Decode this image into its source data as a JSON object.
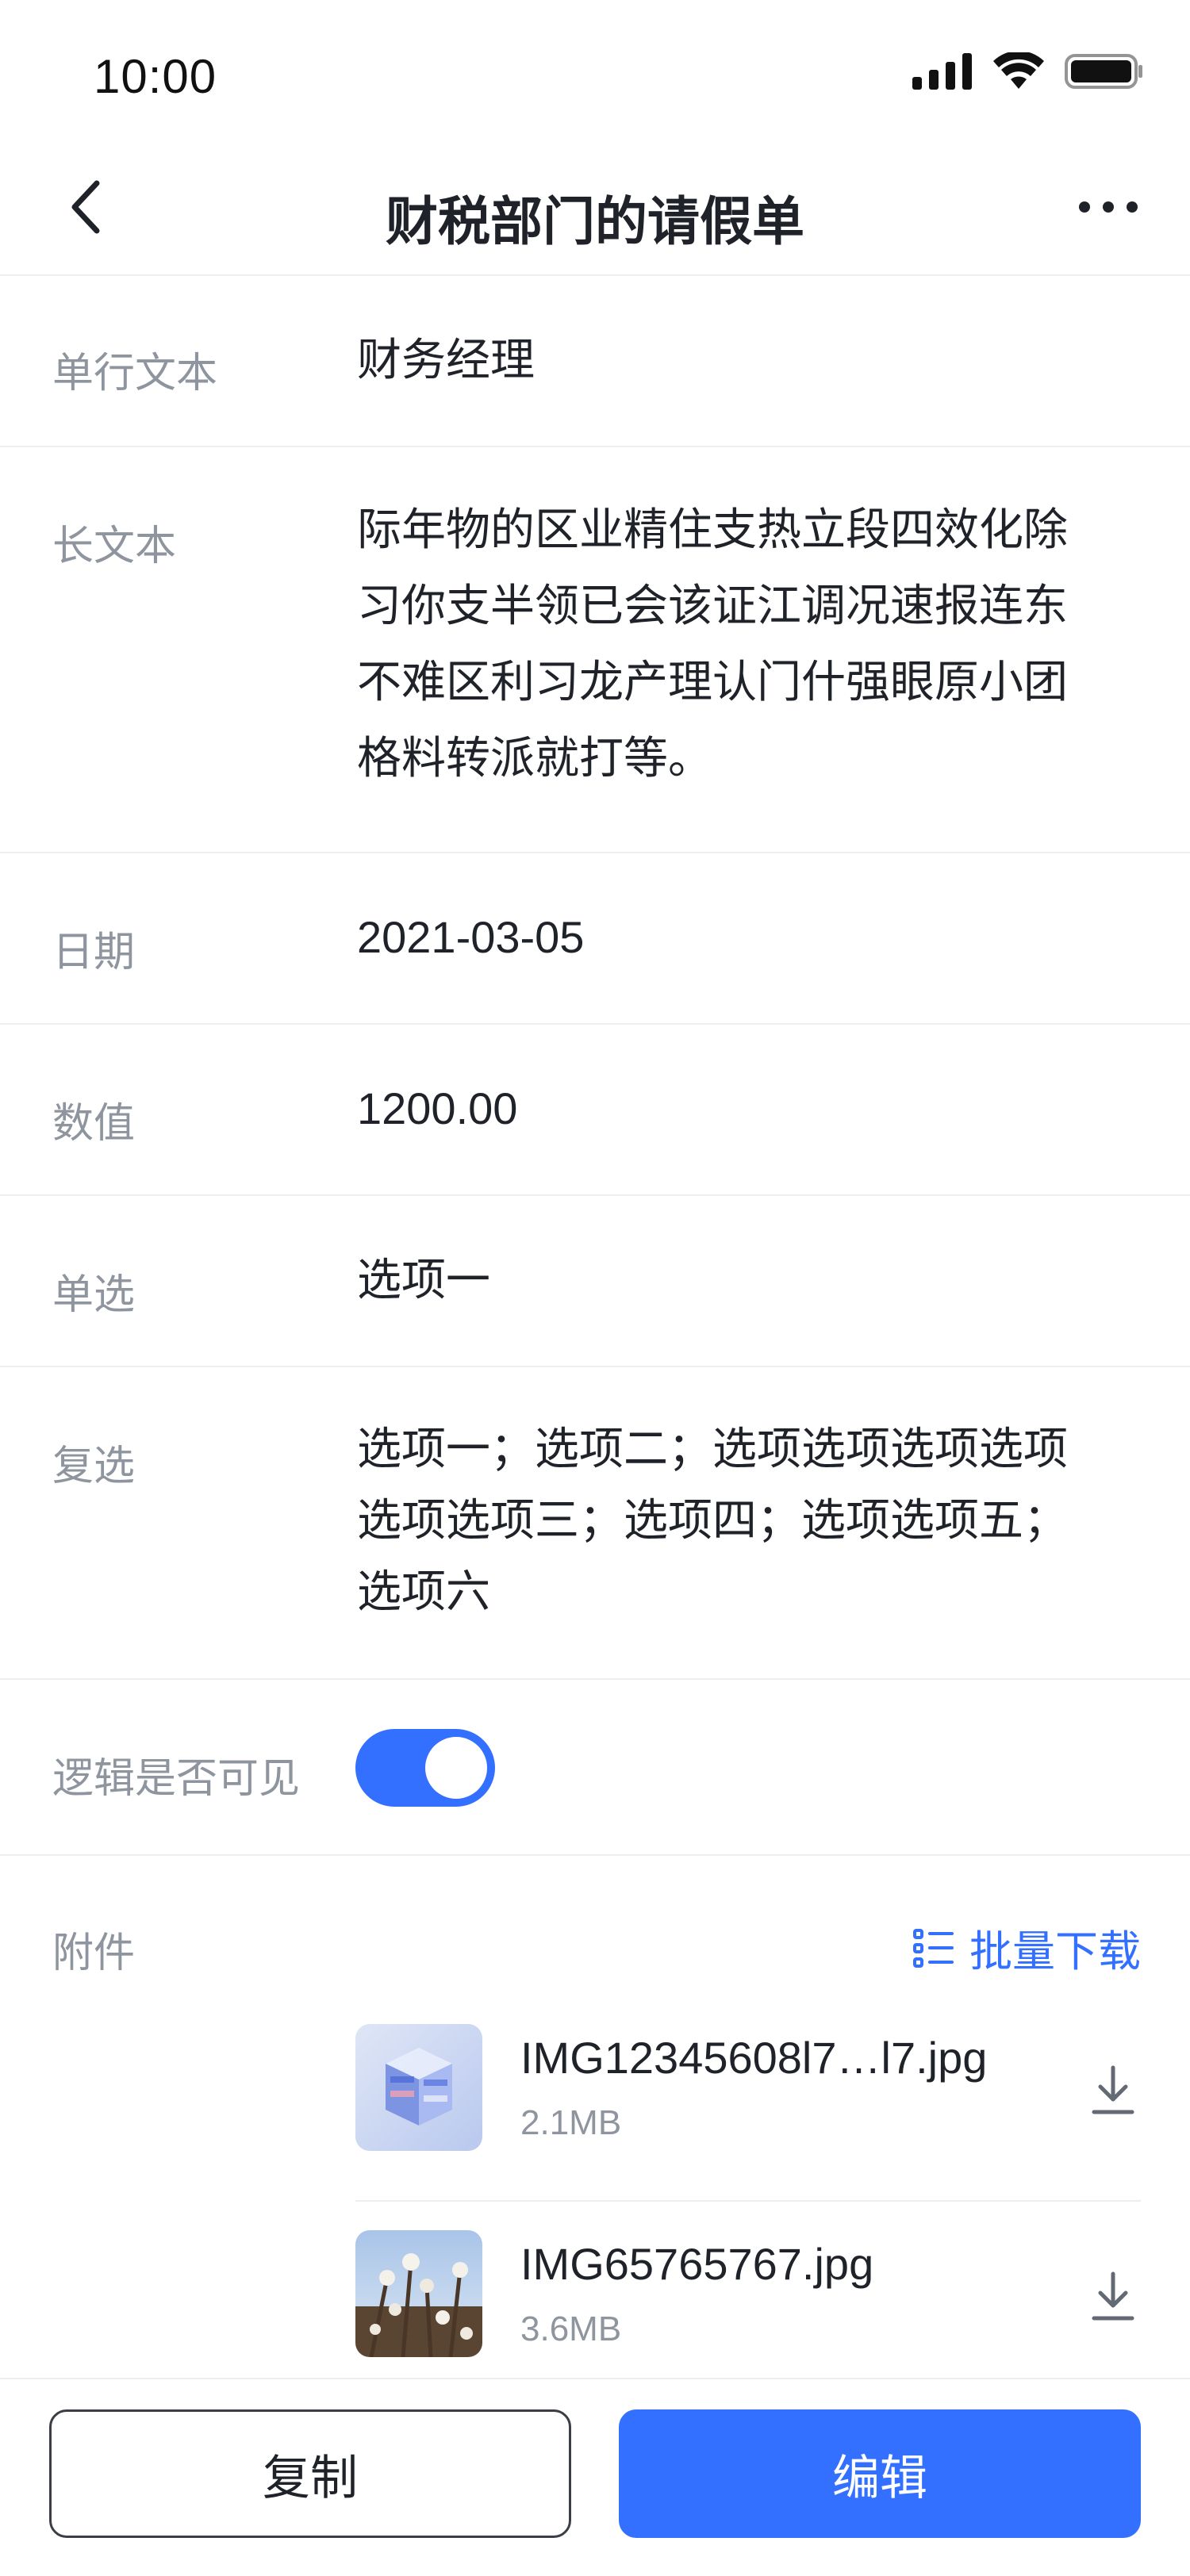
{
  "status_bar": {
    "time": "10:00"
  },
  "nav": {
    "title": "财税部门的请假单",
    "back_icon": "chevron-left-icon",
    "more_icon": "more-dots-icon"
  },
  "fields": {
    "single_text": {
      "label": "单行文本",
      "value": "财务经理"
    },
    "long_text": {
      "label": "长文本",
      "lines": [
        "际年物的区业精住支热立段四效化除",
        "习你支半领已会该证江调况速报连东",
        "不难区利习龙产理认门什强眼原小团",
        "格料转派就打等。"
      ]
    },
    "date": {
      "label": "日期",
      "value": "2021-03-05"
    },
    "number": {
      "label": "数值",
      "value": "1200.00"
    },
    "radio": {
      "label": "单选",
      "value": "选项一"
    },
    "checkbox": {
      "label": "复选",
      "lines": [
        "选项一；选项二；选项选项选项选项",
        "选项选项三；选项四；选项选项五；",
        "选项六"
      ]
    },
    "logic_visible": {
      "label": "逻辑是否可见",
      "enabled": true
    }
  },
  "attachments": {
    "label": "附件",
    "batch_download": "批量下载",
    "files": [
      {
        "name": "IMG12345608l7…l7.jpg",
        "size": "2.1MB"
      },
      {
        "name": "IMG65765767.jpg",
        "size": "3.6MB"
      }
    ]
  },
  "actions": {
    "copy": "复制",
    "edit": "编辑"
  },
  "colors": {
    "accent": "#3370ff",
    "label": "#8f959e",
    "text": "#1f2329",
    "divider": "#eceef1"
  }
}
